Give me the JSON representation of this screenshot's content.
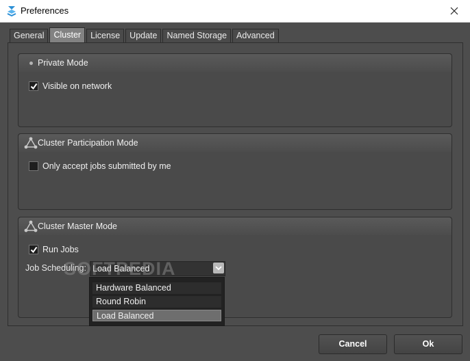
{
  "window": {
    "title": "Preferences",
    "app_icon": "app-logo-icon",
    "close_icon": "close-icon"
  },
  "tabs": [
    {
      "label": "General",
      "active": false
    },
    {
      "label": "Cluster",
      "active": true
    },
    {
      "label": "License",
      "active": false
    },
    {
      "label": "Update",
      "active": false
    },
    {
      "label": "Named Storage",
      "active": false
    },
    {
      "label": "Advanced",
      "active": false
    }
  ],
  "private_mode": {
    "title": "Private Mode",
    "visible_on_network": {
      "label": "Visible on network",
      "checked": true
    }
  },
  "participation": {
    "title": "Cluster Participation Mode",
    "icon": "network-icon",
    "only_mine": {
      "label": "Only accept jobs submitted by me",
      "checked": false
    }
  },
  "master": {
    "title": "Cluster Master Mode",
    "icon": "network-icon",
    "run_jobs": {
      "label": "Run Jobs",
      "checked": true
    },
    "scheduling_label": "Job Scheduling:",
    "scheduling_value": "Load Balanced",
    "options": [
      "Hardware Balanced",
      "Round Robin",
      "Load Balanced"
    ],
    "selected_index": 2
  },
  "watermark": "SOFTPEDIA",
  "buttons": {
    "cancel": "Cancel",
    "ok": "Ok"
  }
}
